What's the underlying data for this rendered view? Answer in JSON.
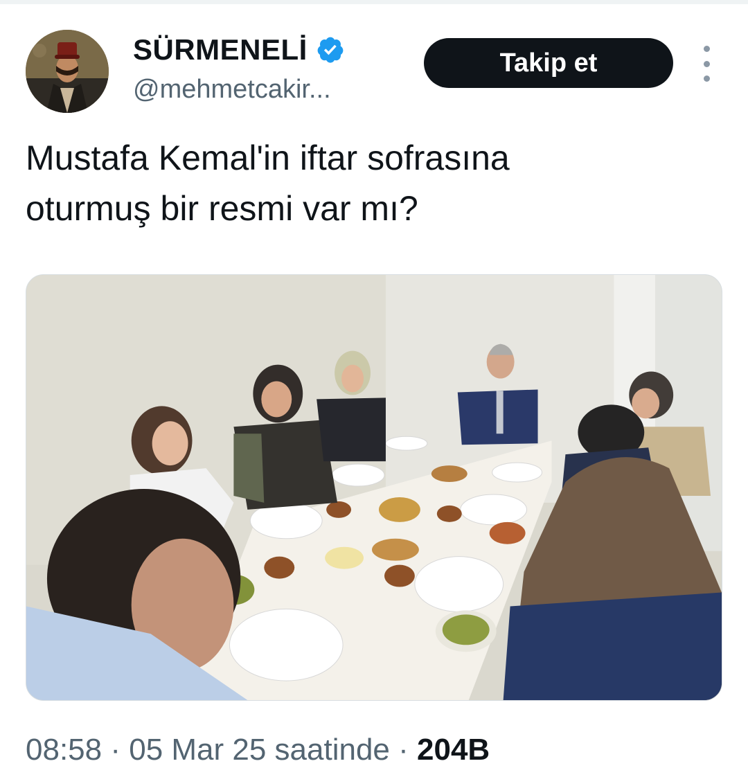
{
  "tweet": {
    "author": {
      "display_name": "SÜRMENELİ",
      "handle": "@mehmetcakir...",
      "verified": true,
      "verified_color": "#1d9bf0"
    },
    "follow_label": "Takip et",
    "text_lines": [
      "Mustafa Kemal'in iftar sofrasına",
      "oturmuş bir resmi var mı?"
    ],
    "meta": {
      "time": "08:58",
      "sep1": " · ",
      "date": "05 Mar 25 saatinde",
      "sep2": " · ",
      "views": "204B"
    }
  },
  "icons": {
    "verified": "verified-badge-icon",
    "more": "more-options-icon"
  },
  "colors": {
    "text": "#0f1419",
    "secondary": "#536471",
    "button_bg": "#0f1419",
    "button_text": "#ffffff"
  }
}
